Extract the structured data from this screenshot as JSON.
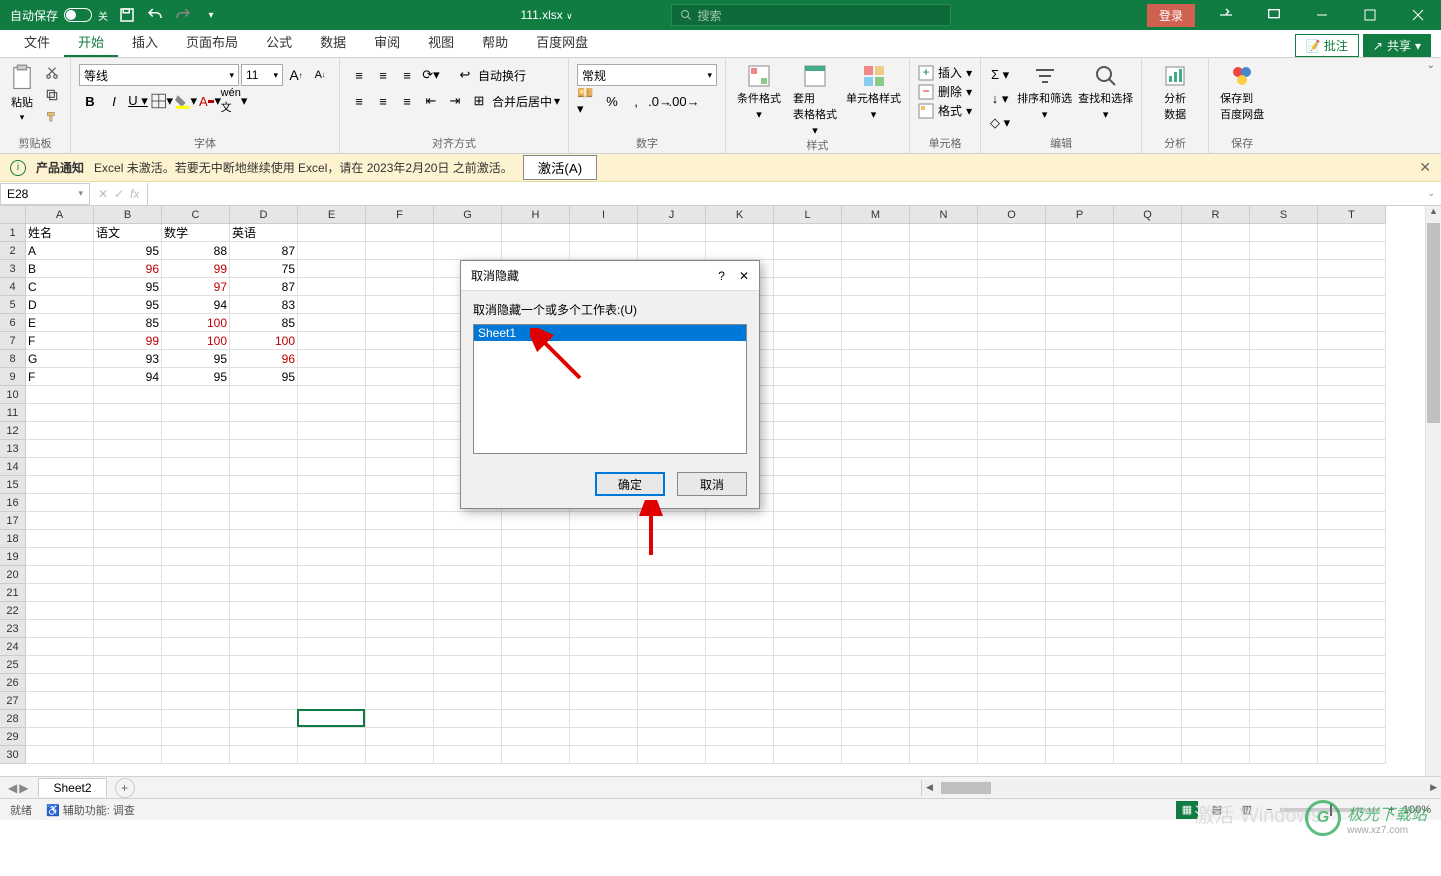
{
  "titlebar": {
    "autosave_label": "自动保存",
    "autosave_state": "关",
    "filename": "111.xlsx",
    "search_placeholder": "搜索",
    "login_label": "登录"
  },
  "menutabs": {
    "items": [
      "文件",
      "开始",
      "插入",
      "页面布局",
      "公式",
      "数据",
      "审阅",
      "视图",
      "帮助",
      "百度网盘"
    ],
    "active_index": 1,
    "comments_label": "批注",
    "share_label": "共享"
  },
  "ribbon": {
    "clipboard": {
      "paste": "粘贴",
      "label": "剪贴板"
    },
    "font": {
      "name": "等线",
      "size": "11",
      "label": "字体"
    },
    "align": {
      "wrap_label": "自动换行",
      "merge_label": "合并后居中",
      "label": "对齐方式"
    },
    "number": {
      "format": "常规",
      "label": "数字"
    },
    "styles": {
      "cond": "条件格式",
      "table": "套用\n表格格式",
      "cell": "单元格样式",
      "label": "样式"
    },
    "cells": {
      "insert": "插入",
      "delete": "删除",
      "format": "格式",
      "label": "单元格"
    },
    "editing": {
      "sort": "排序和筛选",
      "find": "查找和选择",
      "label": "编辑"
    },
    "analysis": {
      "analyze": "分析\n数据",
      "label": "分析"
    },
    "save": {
      "save": "保存到\n百度网盘",
      "label": "保存"
    }
  },
  "notification": {
    "title": "产品通知",
    "message": "Excel 未激活。若要无中断地继续使用 Excel，请在 2023年2月20日 之前激活。",
    "activate_label": "激活(A)"
  },
  "formula_bar": {
    "namebox": "E28"
  },
  "grid": {
    "columns": [
      "A",
      "B",
      "C",
      "D",
      "E",
      "F",
      "G",
      "H",
      "I",
      "J",
      "K",
      "L",
      "M",
      "N",
      "O",
      "P",
      "Q",
      "R",
      "S",
      "T"
    ],
    "row_count": 30,
    "data": [
      {
        "r": 1,
        "c": "A",
        "v": "姓名"
      },
      {
        "r": 1,
        "c": "B",
        "v": "语文"
      },
      {
        "r": 1,
        "c": "C",
        "v": "数学"
      },
      {
        "r": 1,
        "c": "D",
        "v": "英语"
      },
      {
        "r": 2,
        "c": "A",
        "v": "A"
      },
      {
        "r": 2,
        "c": "B",
        "v": "95",
        "num": true
      },
      {
        "r": 2,
        "c": "C",
        "v": "88",
        "num": true
      },
      {
        "r": 2,
        "c": "D",
        "v": "87",
        "num": true
      },
      {
        "r": 3,
        "c": "A",
        "v": "B"
      },
      {
        "r": 3,
        "c": "B",
        "v": "96",
        "num": true,
        "red": true
      },
      {
        "r": 3,
        "c": "C",
        "v": "99",
        "num": true,
        "red": true
      },
      {
        "r": 3,
        "c": "D",
        "v": "75",
        "num": true
      },
      {
        "r": 4,
        "c": "A",
        "v": "C"
      },
      {
        "r": 4,
        "c": "B",
        "v": "95",
        "num": true
      },
      {
        "r": 4,
        "c": "C",
        "v": "97",
        "num": true,
        "red": true
      },
      {
        "r": 4,
        "c": "D",
        "v": "87",
        "num": true
      },
      {
        "r": 5,
        "c": "A",
        "v": "D"
      },
      {
        "r": 5,
        "c": "B",
        "v": "95",
        "num": true
      },
      {
        "r": 5,
        "c": "C",
        "v": "94",
        "num": true
      },
      {
        "r": 5,
        "c": "D",
        "v": "83",
        "num": true
      },
      {
        "r": 6,
        "c": "A",
        "v": "E"
      },
      {
        "r": 6,
        "c": "B",
        "v": "85",
        "num": true
      },
      {
        "r": 6,
        "c": "C",
        "v": "100",
        "num": true,
        "red": true
      },
      {
        "r": 6,
        "c": "D",
        "v": "85",
        "num": true
      },
      {
        "r": 7,
        "c": "A",
        "v": "F"
      },
      {
        "r": 7,
        "c": "B",
        "v": "99",
        "num": true,
        "red": true
      },
      {
        "r": 7,
        "c": "C",
        "v": "100",
        "num": true,
        "red": true
      },
      {
        "r": 7,
        "c": "D",
        "v": "100",
        "num": true,
        "red": true
      },
      {
        "r": 8,
        "c": "A",
        "v": "G"
      },
      {
        "r": 8,
        "c": "B",
        "v": "93",
        "num": true
      },
      {
        "r": 8,
        "c": "C",
        "v": "95",
        "num": true
      },
      {
        "r": 8,
        "c": "D",
        "v": "96",
        "num": true,
        "red": true
      },
      {
        "r": 9,
        "c": "A",
        "v": "F"
      },
      {
        "r": 9,
        "c": "B",
        "v": "94",
        "num": true
      },
      {
        "r": 9,
        "c": "C",
        "v": "95",
        "num": true
      },
      {
        "r": 9,
        "c": "D",
        "v": "95",
        "num": true
      }
    ],
    "active_cell": {
      "row": 28,
      "col": "E"
    }
  },
  "sheets": {
    "tabs": [
      "Sheet2"
    ],
    "active": 0
  },
  "dialog": {
    "title": "取消隐藏",
    "label": "取消隐藏一个或多个工作表:(U)",
    "items": [
      "Sheet1"
    ],
    "selected": 0,
    "ok": "确定",
    "cancel": "取消"
  },
  "statusbar": {
    "ready": "就绪",
    "accessibility": "辅助功能: 调查",
    "zoom": "100%"
  },
  "watermark": {
    "text": "极光下载站",
    "sub": "www.xz7.com"
  },
  "activate_windows": "激活 Windows"
}
